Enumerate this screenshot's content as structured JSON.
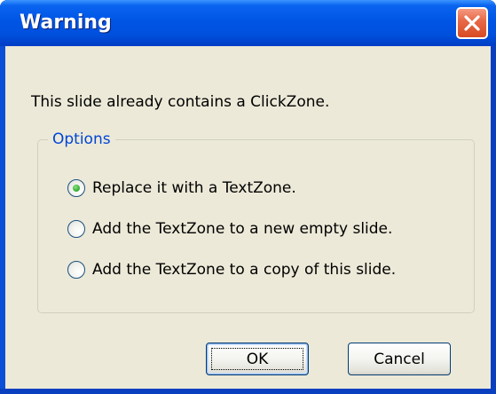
{
  "window": {
    "title": "Warning",
    "close_icon": "close-x-icon"
  },
  "dialog": {
    "message": "This slide already contains a ClickZone.",
    "options_title": "Options",
    "options": [
      {
        "label": "Replace it with a TextZone.",
        "selected": true
      },
      {
        "label": "Add the TextZone to a new empty slide.",
        "selected": false
      },
      {
        "label": "Add the TextZone to a copy of this slide.",
        "selected": false
      }
    ]
  },
  "buttons": {
    "ok_label": "OK",
    "cancel_label": "Cancel"
  },
  "colors": {
    "titlebar": "#0055e5",
    "client_bg": "#ece9d8",
    "group_title": "#0046d5",
    "close_button": "#e86a48",
    "radio_selected": "#3fb53a"
  }
}
